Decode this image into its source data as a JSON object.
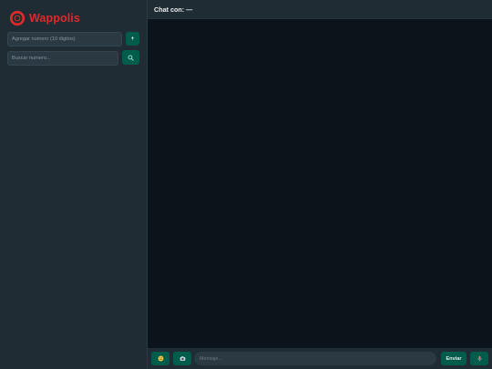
{
  "brand": {
    "name": "Wappolis",
    "color": "#e0292b",
    "logo_icon": "ring-logo-icon"
  },
  "sidebar": {
    "add_number": {
      "placeholder": "Agregar numero (10 digitos)",
      "button_label": "+"
    },
    "search": {
      "placeholder": "Buscar numero...",
      "button_icon": "search-icon"
    }
  },
  "chat": {
    "header_title": "Chat con: —",
    "composer": {
      "emoji_icon": "emoji-icon",
      "camera_icon": "camera-icon",
      "message_placeholder": "Mensaje...",
      "send_label": "Enviar",
      "mic_icon": "mic-icon"
    }
  },
  "colors": {
    "accent_green": "#005c4b",
    "panel": "#202c33",
    "chat_bg": "#0b141a",
    "input_bg": "#2a3942"
  }
}
